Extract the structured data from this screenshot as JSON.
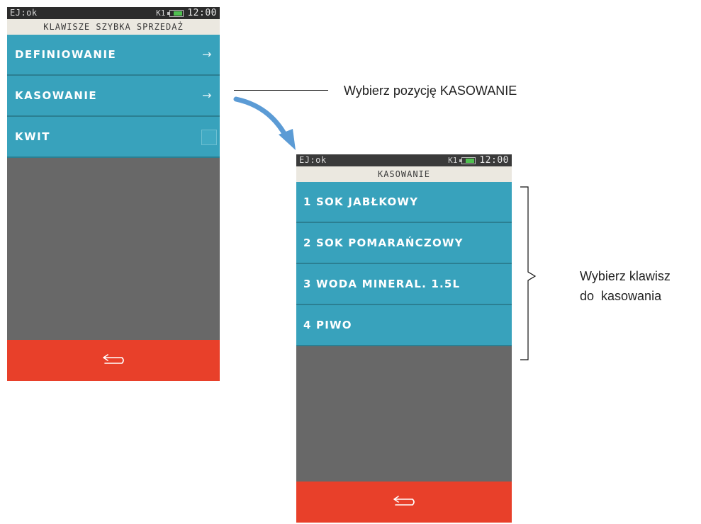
{
  "screen1": {
    "status": {
      "left": "EJ:ok",
      "k1": "K1",
      "time": "12:00"
    },
    "title": "KLAWISZE SZYBKA SPRZEDAŻ",
    "items": [
      {
        "label": "DEFINIOWANIE",
        "arrow": "→"
      },
      {
        "label": "KASOWANIE",
        "arrow": "→"
      },
      {
        "label": "KWIT"
      }
    ],
    "back_icon": "return-arrow-icon"
  },
  "screen2": {
    "status": {
      "left": "EJ:ok",
      "k1": "K1",
      "time": "12:00"
    },
    "title": "KASOWANIE",
    "items": [
      {
        "label": "1 SOK JABŁKOWY"
      },
      {
        "label": "2 SOK POMARAŃCZOWY"
      },
      {
        "label": "3 WODA MINERAL. 1.5L"
      },
      {
        "label": "4 PIWO"
      }
    ],
    "back_icon": "return-arrow-icon"
  },
  "annotations": {
    "select_kasowanie": "Wybierz pozycję KASOWANIE",
    "select_key_line1": "Wybierz klawisz",
    "select_key_line2": "do  kasowania"
  },
  "colors": {
    "menu_item": "#38a2bc",
    "background": "#686868",
    "bottom_bar": "#e8402a",
    "arrow": "#5b9bd5"
  }
}
